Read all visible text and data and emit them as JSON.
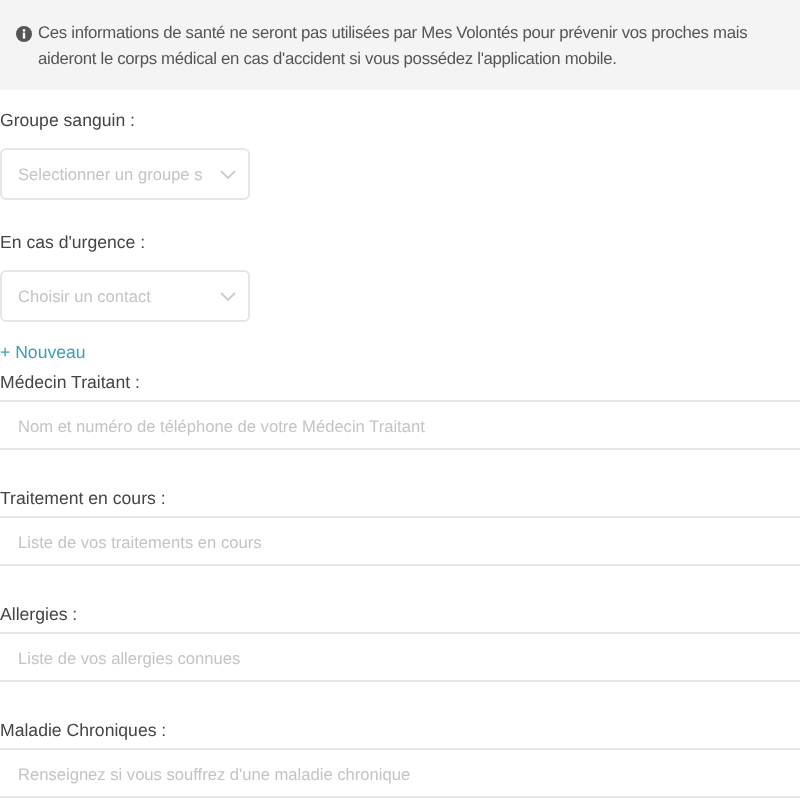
{
  "notice": {
    "text": "Ces informations de santé ne seront pas utilisées par Mes Volontés pour prévenir vos proches mais aideront le corps médical en cas d'accident si vous possédez l'application mobile."
  },
  "fields": [
    {
      "kind": "select",
      "label": "Groupe sanguin :",
      "placeholder": "Selectionner un groupe s"
    },
    {
      "kind": "select",
      "label": "En cas d'urgence :",
      "placeholder": "Choisir un contact",
      "link": "+ Nouveau"
    },
    {
      "kind": "text",
      "label": "Médecin Traitant :",
      "placeholder": "Nom et numéro de téléphone de votre Médecin Traitant"
    },
    {
      "kind": "text",
      "label": "Traitement en cours :",
      "placeholder": "Liste de vos traitements en cours"
    },
    {
      "kind": "text",
      "label": "Allergies :",
      "placeholder": "Liste de vos allergies connues"
    },
    {
      "kind": "text",
      "label": "Maladie Chroniques :",
      "placeholder": "Renseignez si vous souffrez d'une maladie chronique"
    }
  ]
}
